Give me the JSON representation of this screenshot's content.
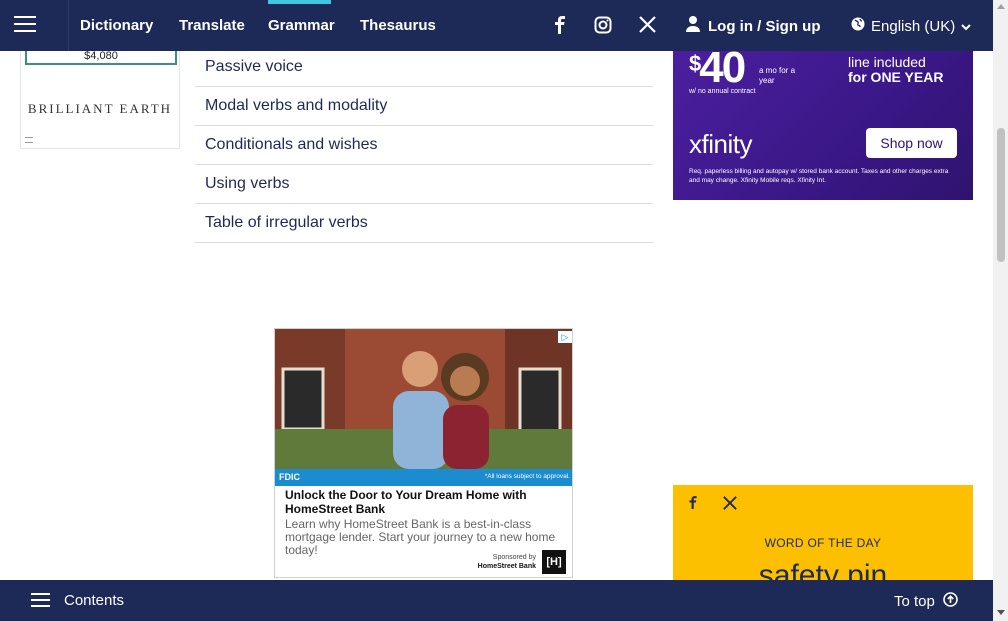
{
  "nav": {
    "links": [
      "Dictionary",
      "Translate",
      "Grammar",
      "Thesaurus"
    ],
    "active": "Grammar",
    "login": "Log in / Sign up",
    "language": "English (UK)",
    "icons": [
      "facebook-icon",
      "instagram-icon",
      "x-icon",
      "user-icon",
      "globe-icon",
      "chevron-down-icon"
    ]
  },
  "left_ad": {
    "price": "$4,080",
    "brand": "BRILLIANT EARTH"
  },
  "grammar_list": {
    "items": [
      "Passive voice",
      "Modal verbs and modality",
      "Conditionals and wishes",
      "Using verbs",
      "Table of irregular verbs"
    ]
  },
  "xfinity_ad": {
    "price": "40",
    "price_currency": "$",
    "per": "a mo for a year",
    "contract": "w/ no annual contract",
    "line_text": "line included",
    "line_period": "for ONE YEAR",
    "logo": "xfinity",
    "button": "Shop now",
    "fine_print": "Req. paperless billing and autopay w/ stored bank account. Taxes and other charges extra and may change. Xfinity Mobile reqs. Xfinity Int."
  },
  "center_ad": {
    "fdic": "FDIC",
    "note": "*All loans subject to approval.",
    "headline": "Unlock the Door to Your Dream Home with HomeStreet Bank",
    "body": "Learn why HomeStreet Bank is a best-in-class mortgage lender. Start your journey to a new home today!",
    "sponsored_by": "Sponsored by",
    "sponsor": "HomeStreet Bank",
    "logo_letter": "[H]"
  },
  "word_of_the_day": {
    "title": "WORD OF THE DAY",
    "word": "safety pin"
  },
  "bottom_bar": {
    "contents": "Contents",
    "to_top": "To top"
  }
}
